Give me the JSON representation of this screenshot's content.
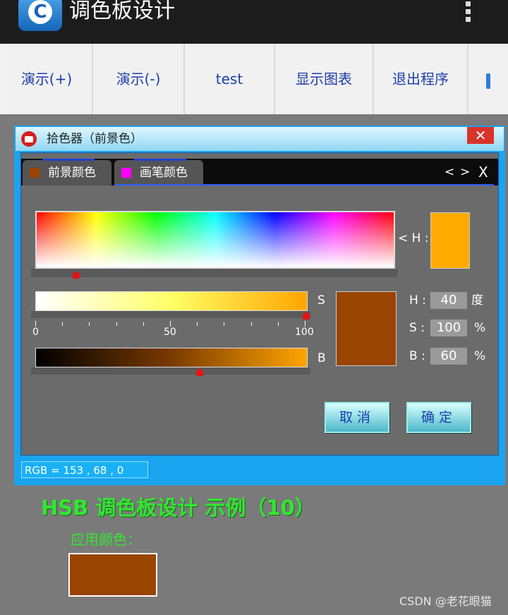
{
  "app": {
    "title": "调色板设计",
    "icon_letter": "C",
    "menu_icon": "overflow-menu-icon"
  },
  "toolbar": [
    {
      "label": "演示(+)"
    },
    {
      "label": "演示(-)"
    },
    {
      "label": "test"
    },
    {
      "label": "显示图表"
    },
    {
      "label": "退出程序"
    }
  ],
  "dialog": {
    "title": "拾色器（前景色）",
    "close_label": "✕",
    "tabs": [
      {
        "label": "前景颜色",
        "swatch_color": "#994400"
      },
      {
        "label": "画笔颜色",
        "swatch_color": "#ff00ff"
      }
    ],
    "nav": {
      "prev": "<",
      "next": ">",
      "close": "X"
    },
    "hue_label": "< H :",
    "hue_value": 40,
    "hue_swatch_color": "#ffaa00",
    "sat_letter": "S",
    "bri_letter": "B",
    "scale_labels": [
      "0",
      "50",
      "100"
    ],
    "preview_color": "#994400",
    "fields": {
      "h_label": "H :",
      "h_value": "40",
      "h_unit": "度",
      "s_label": "S :",
      "s_value": "100",
      "s_unit": "%",
      "b_label": "B :",
      "b_value": "60",
      "b_unit": "%"
    },
    "cancel_label": "取消",
    "ok_label": "确定",
    "status": "RGB = 153 , 68 , 0"
  },
  "main": {
    "heading": "HSB 调色板设计  示例（10）",
    "apply_label": "应用颜色：",
    "apply_color": "#994400"
  },
  "watermark": "CSDN @老花眼猫",
  "colors": {
    "dialog_border": "#1aa3ef",
    "accent": "#32e632",
    "toolbar_text": "#1f3fa8"
  }
}
